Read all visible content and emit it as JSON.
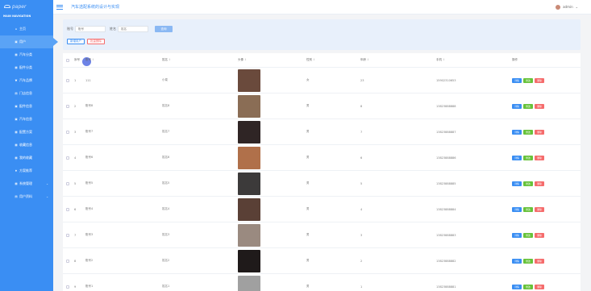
{
  "brand": {
    "logo_text": "paper"
  },
  "header": {
    "title": "汽车选配系统的设计与实现",
    "user_name": "admin",
    "user_caret": "⌄"
  },
  "sidebar": {
    "nav_title": "MAIN NAVIGATION",
    "items": [
      {
        "label": "主页",
        "icon": "home-icon",
        "glyph": "⌂"
      },
      {
        "label": "用户",
        "icon": "user-icon",
        "glyph": "▣"
      },
      {
        "label": "汽车分类",
        "icon": "grid-icon",
        "glyph": "▦"
      },
      {
        "label": "配件分类",
        "icon": "grid-icon",
        "glyph": "▦"
      },
      {
        "label": "汽车品牌",
        "icon": "tag-icon",
        "glyph": "▼"
      },
      {
        "label": "门店信息",
        "icon": "store-icon",
        "glyph": "▤"
      },
      {
        "label": "配件信息",
        "icon": "box-icon",
        "glyph": "▣"
      },
      {
        "label": "汽车信息",
        "icon": "car-icon",
        "glyph": "▣"
      },
      {
        "label": "配置方案",
        "icon": "settings-icon",
        "glyph": "▦"
      },
      {
        "label": "收藏信息",
        "icon": "star-icon",
        "glyph": "▦"
      },
      {
        "label": "我的收藏",
        "icon": "heart-icon",
        "glyph": "▦"
      },
      {
        "label": "方案推荐",
        "icon": "pin-icon",
        "glyph": "♦"
      },
      {
        "label": "系统管理",
        "icon": "system-icon",
        "glyph": "▦",
        "chevron": "⌄"
      },
      {
        "label": "用户资料",
        "icon": "profile-icon",
        "glyph": "▤",
        "chevron": "⌄"
      }
    ]
  },
  "search": {
    "field1_label": "账号",
    "field1_placeholder": "账号",
    "field2_label": "姓名",
    "field2_placeholder": "姓名",
    "search_button": "查询",
    "add_button": "新增用户",
    "batch_delete_button": "批量删除"
  },
  "table": {
    "headers": {
      "idx": "序号",
      "username": "账号",
      "name": "姓名",
      "avatar": "头像",
      "gender": "性别",
      "age": "年龄",
      "phone": "手机",
      "ops": "操作"
    },
    "sort_glyph": "⇕",
    "ops": {
      "detail": "详情",
      "edit": "修改",
      "delete": "删除"
    },
    "rows": [
      {
        "idx": "1",
        "username": "111",
        "name": "小菜",
        "gender": "女",
        "age": "23",
        "phone": "15902310653",
        "photo": "#6a4a3c"
      },
      {
        "idx": "2",
        "username": "账号8",
        "name": "姓名8",
        "gender": "男",
        "age": "8",
        "phone": "13823888888",
        "photo": "#8a6d55"
      },
      {
        "idx": "3",
        "username": "账号7",
        "name": "姓名7",
        "gender": "男",
        "age": "7",
        "phone": "13823888887",
        "photo": "#2f2525"
      },
      {
        "idx": "4",
        "username": "账号6",
        "name": "姓名6",
        "gender": "男",
        "age": "6",
        "phone": "13823888886",
        "photo": "#b0704a"
      },
      {
        "idx": "5",
        "username": "账号5",
        "name": "姓名5",
        "gender": "男",
        "age": "5",
        "phone": "13823888885",
        "photo": "#3c3a3a"
      },
      {
        "idx": "6",
        "username": "账号4",
        "name": "姓名4",
        "gender": "男",
        "age": "4",
        "phone": "13823888884",
        "photo": "#5a4036"
      },
      {
        "idx": "7",
        "username": "账号3",
        "name": "姓名3",
        "gender": "男",
        "age": "3",
        "phone": "13823888883",
        "photo": "#9a8a80"
      },
      {
        "idx": "8",
        "username": "账号2",
        "name": "姓名2",
        "gender": "男",
        "age": "2",
        "phone": "13823888882",
        "photo": "#1f1a1a"
      },
      {
        "idx": "9",
        "username": "账号1",
        "name": "姓名1",
        "gender": "男",
        "age": "1",
        "phone": "13823888881",
        "photo": "#a0a0a0"
      }
    ]
  }
}
